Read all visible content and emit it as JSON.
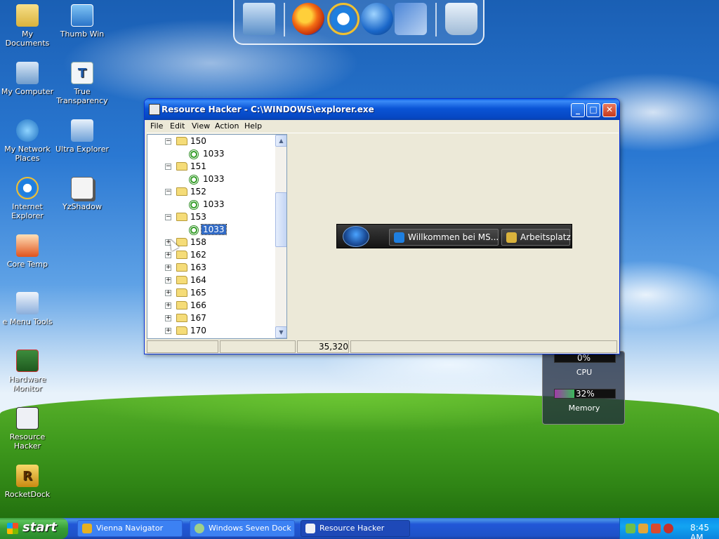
{
  "desktop": {
    "icons": [
      {
        "label": "My Documents"
      },
      {
        "label": "Thumb Win"
      },
      {
        "label": "My Computer"
      },
      {
        "label": "True Transparency"
      },
      {
        "label": "My Network Places"
      },
      {
        "label": "Ultra Explorer"
      },
      {
        "label": "Internet Explorer"
      },
      {
        "label": "YzShadow"
      },
      {
        "label": "Core Temp"
      },
      {
        "label": "e Menu Tools"
      },
      {
        "label": "Hardware Monitor"
      },
      {
        "label": "Resource Hacker"
      },
      {
        "label": "RocketDock"
      }
    ]
  },
  "window": {
    "title": "Resource Hacker  -  C:\\WINDOWS\\explorer.exe",
    "menu": [
      "File",
      "Edit",
      "View",
      "Action",
      "Help"
    ],
    "tree": [
      {
        "label": "150",
        "type": "folder",
        "expanded": true
      },
      {
        "label": "1033",
        "type": "resource"
      },
      {
        "label": "151",
        "type": "folder",
        "expanded": true
      },
      {
        "label": "1033",
        "type": "resource"
      },
      {
        "label": "152",
        "type": "folder",
        "expanded": true
      },
      {
        "label": "1033",
        "type": "resource"
      },
      {
        "label": "153",
        "type": "folder",
        "expanded": true
      },
      {
        "label": "1033",
        "type": "resource",
        "selected": true
      },
      {
        "label": "158",
        "type": "folder",
        "expanded": false
      },
      {
        "label": "162",
        "type": "folder",
        "expanded": false
      },
      {
        "label": "163",
        "type": "folder",
        "expanded": false
      },
      {
        "label": "164",
        "type": "folder",
        "expanded": false
      },
      {
        "label": "165",
        "type": "folder",
        "expanded": false
      },
      {
        "label": "166",
        "type": "folder",
        "expanded": false
      },
      {
        "label": "167",
        "type": "folder",
        "expanded": false
      },
      {
        "label": "170",
        "type": "folder",
        "expanded": false
      }
    ],
    "preview": {
      "tasks": [
        "Willkommen bei MS...",
        "Arbeitsplatz"
      ]
    },
    "status": {
      "panel_1": "",
      "panel_2": "",
      "panel_3": "35,320"
    }
  },
  "gadget": {
    "cpu_label": "CPU",
    "cpu_value": "0%",
    "memory_label": "Memory",
    "memory_value": "32%",
    "memory_fraction": 0.32
  },
  "taskbar": {
    "start_label": "start",
    "tasks": [
      {
        "label": "Vienna Navigator",
        "active": false
      },
      {
        "label": "Windows Seven Dock",
        "active": false
      },
      {
        "label": "Resource Hacker",
        "active": true
      }
    ],
    "clock": "8:45 AM"
  },
  "colors": {
    "titlebar": "#0a54d6",
    "selection": "#316ac5",
    "taskbar": "#1e52c8",
    "start_button": "#379e37"
  }
}
